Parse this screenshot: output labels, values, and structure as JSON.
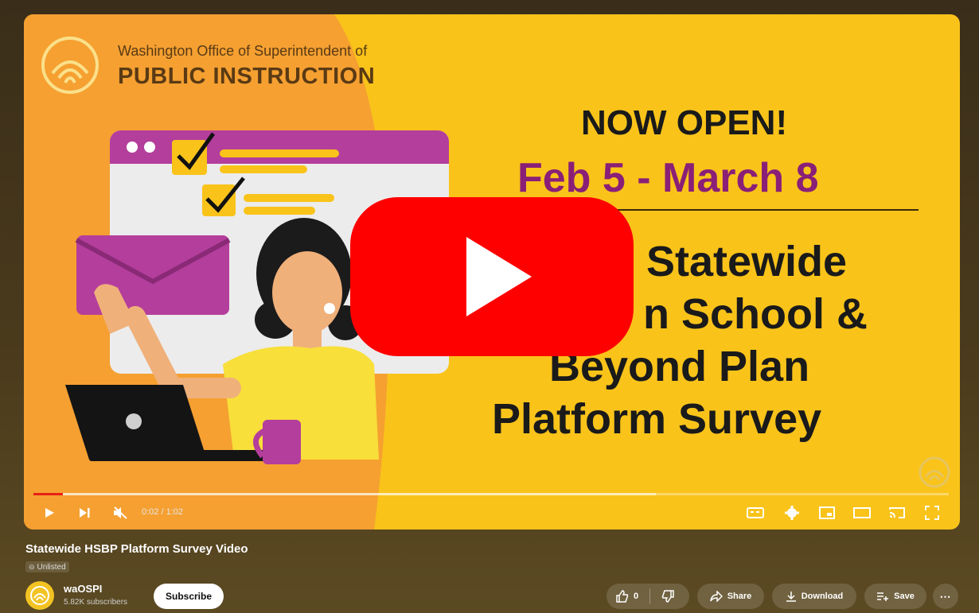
{
  "video": {
    "org_line1": "Washington Office of Superintendent of",
    "org_line2": "PUBLIC INSTRUCTION",
    "headline": "NOW OPEN!",
    "dates": "Feb 5 - March 8",
    "line1": "Statewide",
    "line2": "n School &",
    "line3": "Beyond Plan",
    "line4": "Platform Survey",
    "progress_fraction": 0.032
  },
  "player": {
    "time": "0:02 / 1:02"
  },
  "meta": {
    "title": "Statewide HSBP Platform Survey Video",
    "visibility": "Unlisted",
    "channel": "waOSPI",
    "subscribers": "5.82K subscribers",
    "subscribe_label": "Subscribe",
    "like_count": "0",
    "share_label": "Share",
    "download_label": "Download",
    "save_label": "Save"
  },
  "colors": {
    "accent": "#8a1f77",
    "youtube_red": "#ff0000",
    "background_yellow": "#f9c31a"
  }
}
